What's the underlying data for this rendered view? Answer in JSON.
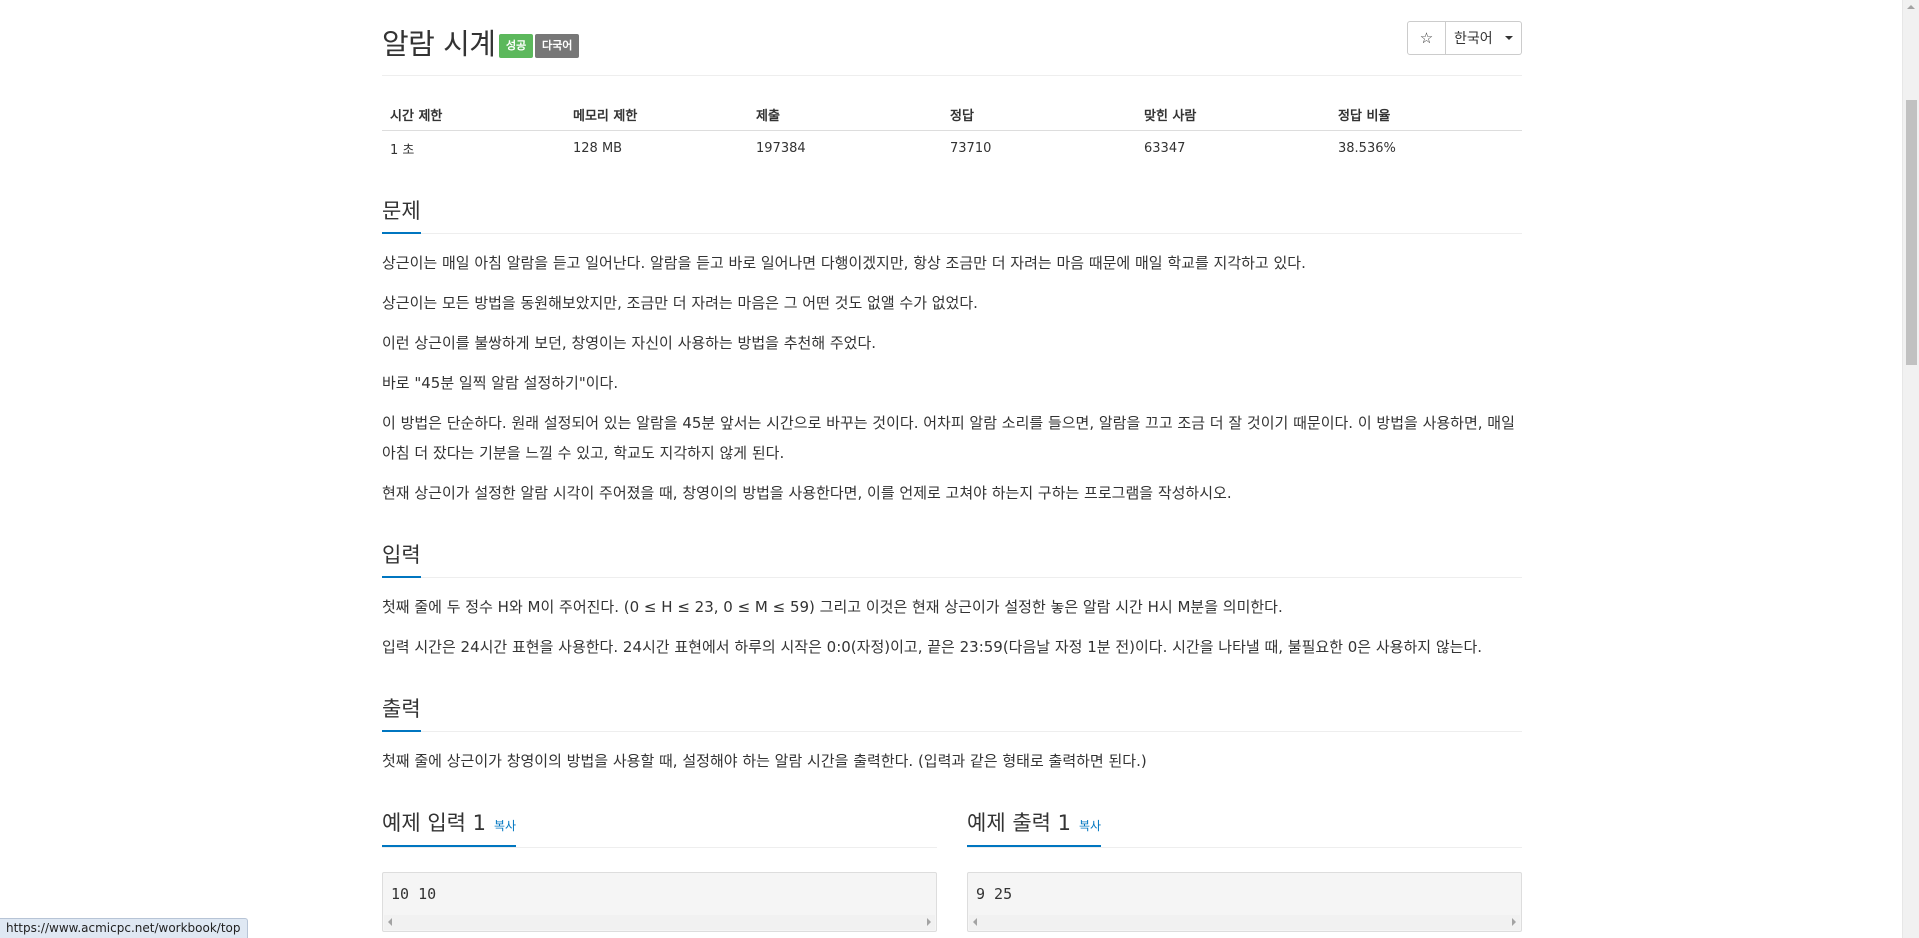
{
  "problem": {
    "title": "알람 시계",
    "badge_success": "성공",
    "badge_multilang": "다국어",
    "star_icon": "☆",
    "language": "한국어"
  },
  "stats": {
    "headers": [
      "시간 제한",
      "메모리 제한",
      "제출",
      "정답",
      "맞힌 사람",
      "정답 비율"
    ],
    "values": [
      "1 초",
      "128 MB",
      "197384",
      "73710",
      "63347",
      "38.536%"
    ]
  },
  "sections": {
    "problem": {
      "heading": "문제",
      "paragraphs": [
        "상근이는 매일 아침 알람을 듣고 일어난다. 알람을 듣고 바로 일어나면 다행이겠지만, 항상 조금만 더 자려는 마음 때문에 매일 학교를 지각하고 있다.",
        "상근이는 모든 방법을 동원해보았지만, 조금만 더 자려는 마음은 그 어떤 것도 없앨 수가 없었다.",
        "이런 상근이를 불쌍하게 보던, 창영이는 자신이 사용하는 방법을 추천해 주었다.",
        "바로 \"45분 일찍 알람 설정하기\"이다.",
        "이 방법은 단순하다. 원래 설정되어 있는 알람을 45분 앞서는 시간으로 바꾸는 것이다. 어차피 알람 소리를 들으면, 알람을 끄고 조금 더 잘 것이기 때문이다. 이 방법을 사용하면, 매일 아침 더 잤다는 기분을 느낄 수 있고, 학교도 지각하지 않게 된다.",
        "현재 상근이가 설정한 알람 시각이 주어졌을 때, 창영이의 방법을 사용한다면, 이를 언제로 고쳐야 하는지 구하는 프로그램을 작성하시오."
      ]
    },
    "input": {
      "heading": "입력",
      "paragraphs": [
        "첫째 줄에 두 정수 H와 M이 주어진다. (0 ≤ H ≤ 23, 0 ≤ M ≤ 59) 그리고 이것은 현재 상근이가 설정한 놓은 알람 시간 H시 M분을 의미한다.",
        "입력 시간은 24시간 표현을 사용한다. 24시간 표현에서 하루의 시작은 0:0(자정)이고, 끝은 23:59(다음날 자정 1분 전)이다. 시간을 나타낼 때, 불필요한 0은 사용하지 않는다."
      ]
    },
    "output": {
      "heading": "출력",
      "paragraphs": [
        "첫째 줄에 상근이가 창영이의 방법을 사용할 때, 설정해야 하는 알람 시간을 출력한다. (입력과 같은 형태로 출력하면 된다.)"
      ]
    }
  },
  "samples": {
    "input": {
      "heading": "예제 입력 1",
      "copy": "복사",
      "content": "10 10"
    },
    "output": {
      "heading": "예제 출력 1",
      "copy": "복사",
      "content": "9 25"
    }
  },
  "statusbar": {
    "url": "https://www.acmicpc.net/workbook/top"
  }
}
